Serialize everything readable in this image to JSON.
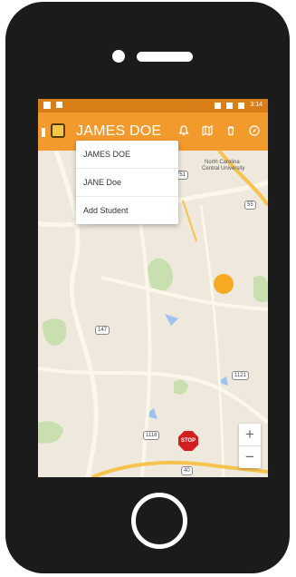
{
  "app": {
    "title": "JAMES DOE",
    "status_time": "3:14"
  },
  "dropdown": {
    "items": [
      "JAMES DOE",
      "JANE Doe",
      "Add Student"
    ]
  },
  "map": {
    "labels": [
      "North Carolina",
      "Central University"
    ],
    "route_shields": [
      "751",
      "55",
      "147",
      "1121",
      "1118",
      "40"
    ],
    "stop_label": "STOP"
  },
  "zoom": {
    "in_label": "+",
    "out_label": "−"
  },
  "colors": {
    "appbar": "#f39a2d",
    "statusbar": "#d97d17",
    "stop_sign": "#d11f1f",
    "location_dot": "#f6aa24"
  }
}
